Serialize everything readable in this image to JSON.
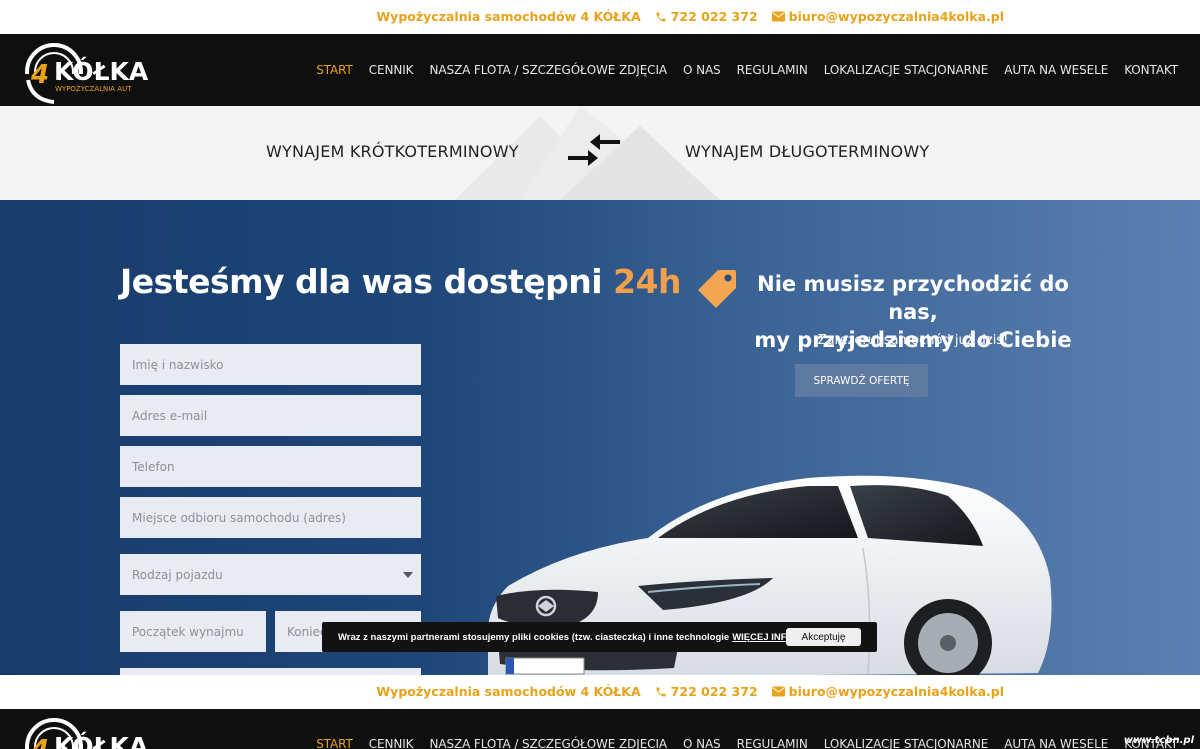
{
  "topbar": {
    "company": "Wypożyczalnia samochodów 4 KÓŁKA",
    "phone": "722 022 372",
    "email": "biuro@wypozyczalnia4kolka.pl"
  },
  "logo": {
    "number": "4",
    "name": "KÓŁKA",
    "tagline": "WYPOŻYCZALNIA AUT"
  },
  "menu": {
    "items": [
      "START",
      "CENNIK",
      "NASZA FLOTA / SZCZEGÓŁOWE ZDJĘCIA",
      "O NAS",
      "REGULAMIN",
      "LOKALIZACJE STACJONARNE",
      "AUTA NA WESELE",
      "KONTAKT"
    ],
    "active": "START"
  },
  "rental_types": {
    "short": "WYNAJEM KRÓTKOTERMINOWY",
    "long": "WYNAJEM DŁUGOTERMINOWY"
  },
  "hero": {
    "title": "Jesteśmy dla was dostępni",
    "title_accent": "24h",
    "accent_color": "#f0a04b"
  },
  "form": {
    "name": "Imię i nazwisko",
    "email": "Adres e-mail",
    "phone": "Telefon",
    "pickup": "Miejsce odbioru samochodu (adres)",
    "vehicle": "Rodzaj pojazdu",
    "start": "Początek wynajmu",
    "end": "Koniec wynajmu"
  },
  "promo": {
    "line1": "Nie musisz przychodzić do nas,",
    "line2": "my przyjedziemy do Ciebie",
    "subtitle": "Zarezeruj samochód już dziś!",
    "button": "SPRAWDŹ OFERTĘ",
    "icon": "price-tag-icon"
  },
  "cookie": {
    "text": "Wraz z naszymi partnerami stosujemy pliki cookies (tzw. ciasteczka) i inne technologie",
    "more": "WIĘCEJ INFORMACJI",
    "accept": "Akceptuję"
  },
  "watermark": "www.tcbn.pl",
  "colors": {
    "brand": "#e8a21a",
    "nav_bg": "#0f0f0f",
    "hero_start": "#173b6b",
    "hero_end": "#5b7fb0"
  }
}
